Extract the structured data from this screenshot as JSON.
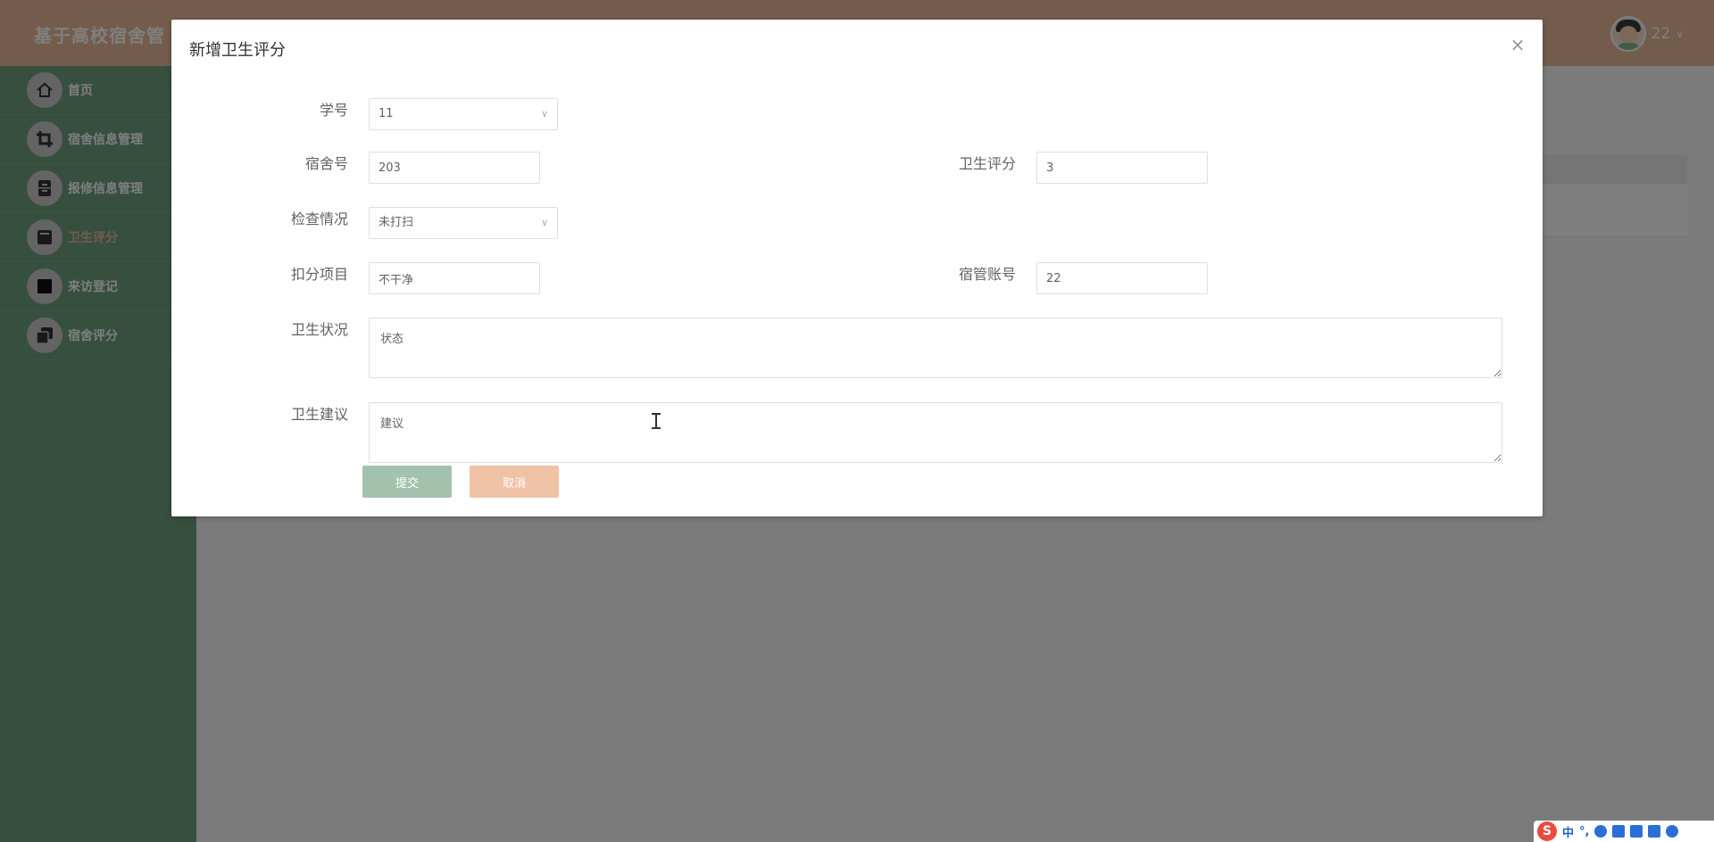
{
  "app": {
    "title": "基于高校宿舍管",
    "user_name": "22",
    "user_chevron": "∨"
  },
  "sidebar": {
    "items": [
      {
        "label": "首页",
        "icon": "home-icon",
        "active": false
      },
      {
        "label": "宿舍信息管理",
        "icon": "crop-icon",
        "active": false
      },
      {
        "label": "报修信息管理",
        "icon": "archive-icon",
        "active": false
      },
      {
        "label": "卫生评分",
        "icon": "note-icon",
        "active": true
      },
      {
        "label": "来访登记",
        "icon": "square-icon",
        "active": false
      },
      {
        "label": "宿舍评分",
        "icon": "copy-icon",
        "active": false
      }
    ]
  },
  "dialog": {
    "title": "新增卫生评分",
    "close_symbol": "×",
    "fields": {
      "student_no": {
        "label": "学号",
        "value": "11"
      },
      "dorm_no": {
        "label": "宿舍号",
        "value": "203"
      },
      "hygiene_score": {
        "label": "卫生评分",
        "value": "3"
      },
      "inspection": {
        "label": "检查情况",
        "value": "未打扫"
      },
      "deduction_item": {
        "label": "扣分项目",
        "value": "不干净"
      },
      "manager_account": {
        "label": "宿管账号",
        "value": "22"
      },
      "hygiene_status": {
        "label": "卫生状况",
        "value": "状态"
      },
      "hygiene_advice": {
        "label": "卫生建议",
        "value": "建议"
      }
    },
    "submit_label": "提交",
    "cancel_label": "取消"
  },
  "ime": {
    "logo": "S",
    "mode": "中",
    "punct": "°,"
  },
  "colors": {
    "topbar": "#e9b99a",
    "sidebar": "#6f9e7f",
    "submit": "#a3c2ae",
    "cancel": "#f0c2a6",
    "active_menu": "#e9b99a"
  }
}
